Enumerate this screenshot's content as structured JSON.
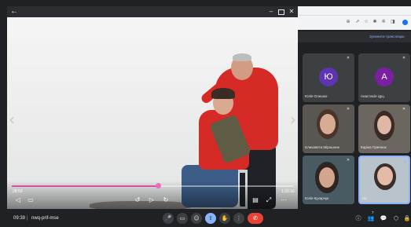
{
  "player": {
    "elapsed": "28:53",
    "duration": "1:32:16",
    "progress_fraction": 0.52,
    "controls": {
      "back": "←",
      "minimize": "–",
      "close": "✕",
      "prev_arrow": "‹",
      "next_arrow": "›",
      "subtitles": "▭",
      "rewind": "↺",
      "play": "▷",
      "forward": "↻",
      "captions": "▤",
      "volume": "◁",
      "settings": "⚙",
      "fullscreen": "⤢",
      "more": "⋯"
    }
  },
  "browser_toolbar": {
    "icons": [
      "⊕",
      "⇗",
      "☆",
      "✱",
      "✲",
      "◨"
    ]
  },
  "banner": {
    "text": "Зупинити трансляцію"
  },
  "participants": [
    {
      "name": "Юлія Олешко",
      "initial": "Ю",
      "avatar_color": "#5e35b1",
      "muted": true
    },
    {
      "name": "Анастасія Цуц",
      "initial": "А",
      "avatar_color": "#7b1fa2",
      "muted": true
    },
    {
      "name": "Єлизавета Мірошник",
      "muted": true
    },
    {
      "name": "Каріна Гуменюк",
      "muted": true
    },
    {
      "name": "Юлія Кухарчук",
      "muted": true
    },
    {
      "name": "Ви",
      "muted": false,
      "selected": true
    }
  ],
  "bottom_bar": {
    "time": "09:39",
    "separator": "|",
    "meeting_code": "nwq-prif-mse",
    "center_icons": [
      "🎤",
      "▭",
      "☺",
      "⇧",
      "✋",
      "⋮",
      "✆"
    ],
    "right_icons": [
      "ⓘ",
      "👥",
      "💬",
      "⬡",
      "🔒"
    ],
    "participant_count": "7"
  }
}
